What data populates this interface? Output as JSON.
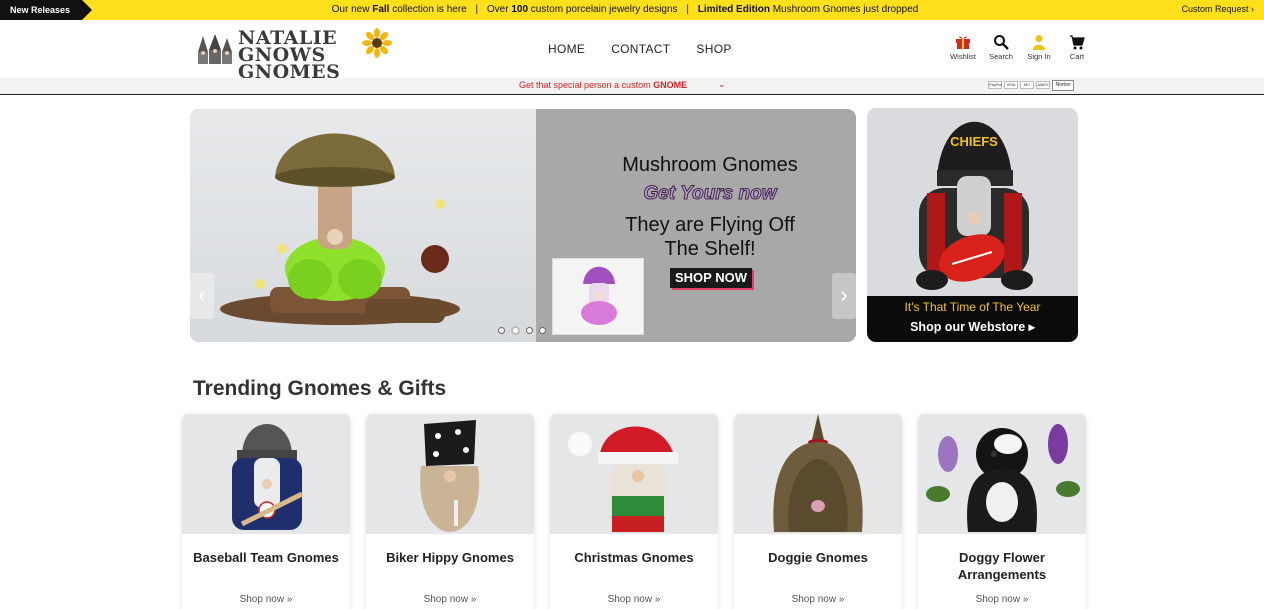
{
  "topbar": {
    "new_releases": "New Releases",
    "announcement": {
      "part1_pre": "Our new ",
      "part1_bold": "Fall",
      "part1_post": " collection is here",
      "part2_pre": "Over ",
      "part2_bold": "100",
      "part2_post": " custom porcelain jewelry designs",
      "part3_bold": "Limited Edition",
      "part3_post": " Mushroom Gnomes just dropped",
      "separator": "|"
    },
    "custom_request": "Custom Request ›",
    "color": "#ffe01a"
  },
  "header": {
    "logo_line1": "NATALIE",
    "logo_line2": "GNOWS GNOMES",
    "nav": [
      "HOME",
      "CONTACT",
      "SHOP"
    ],
    "icons": [
      {
        "label": "Wishlist",
        "icon": "gift-icon"
      },
      {
        "label": "Search",
        "icon": "search-icon"
      },
      {
        "label": "Sign In",
        "icon": "user-icon"
      },
      {
        "label": "Cart",
        "icon": "cart-icon"
      }
    ]
  },
  "subbar": {
    "promo_pre": "Get that special person a custom ",
    "promo_bold": "GNOME",
    "chevron": "⌄",
    "payments": [
      "PayPal",
      "VISA",
      "MC",
      "AMEX"
    ],
    "badge": "Norton"
  },
  "hero": {
    "line1": "Mushroom Gnomes",
    "line2": "Get Yours now",
    "line3a": "They are Flying Off",
    "line3b": "The Shelf!",
    "button": "SHOP NOW",
    "prev": "‹",
    "next": "›",
    "slides": 4,
    "active_slide": 2
  },
  "side_promo": {
    "line1": "It's That Time of The Year",
    "line2": "Shop our Webstore ▸"
  },
  "trending": {
    "title": "Trending Gnomes & Gifts",
    "link_text": "Shop now »",
    "items": [
      {
        "title": "Baseball Team Gnomes"
      },
      {
        "title": "Biker Hippy Gnomes"
      },
      {
        "title": "Christmas Gnomes"
      },
      {
        "title": "Doggie Gnomes"
      },
      {
        "title": "Doggy Flower Arrangements"
      }
    ]
  }
}
